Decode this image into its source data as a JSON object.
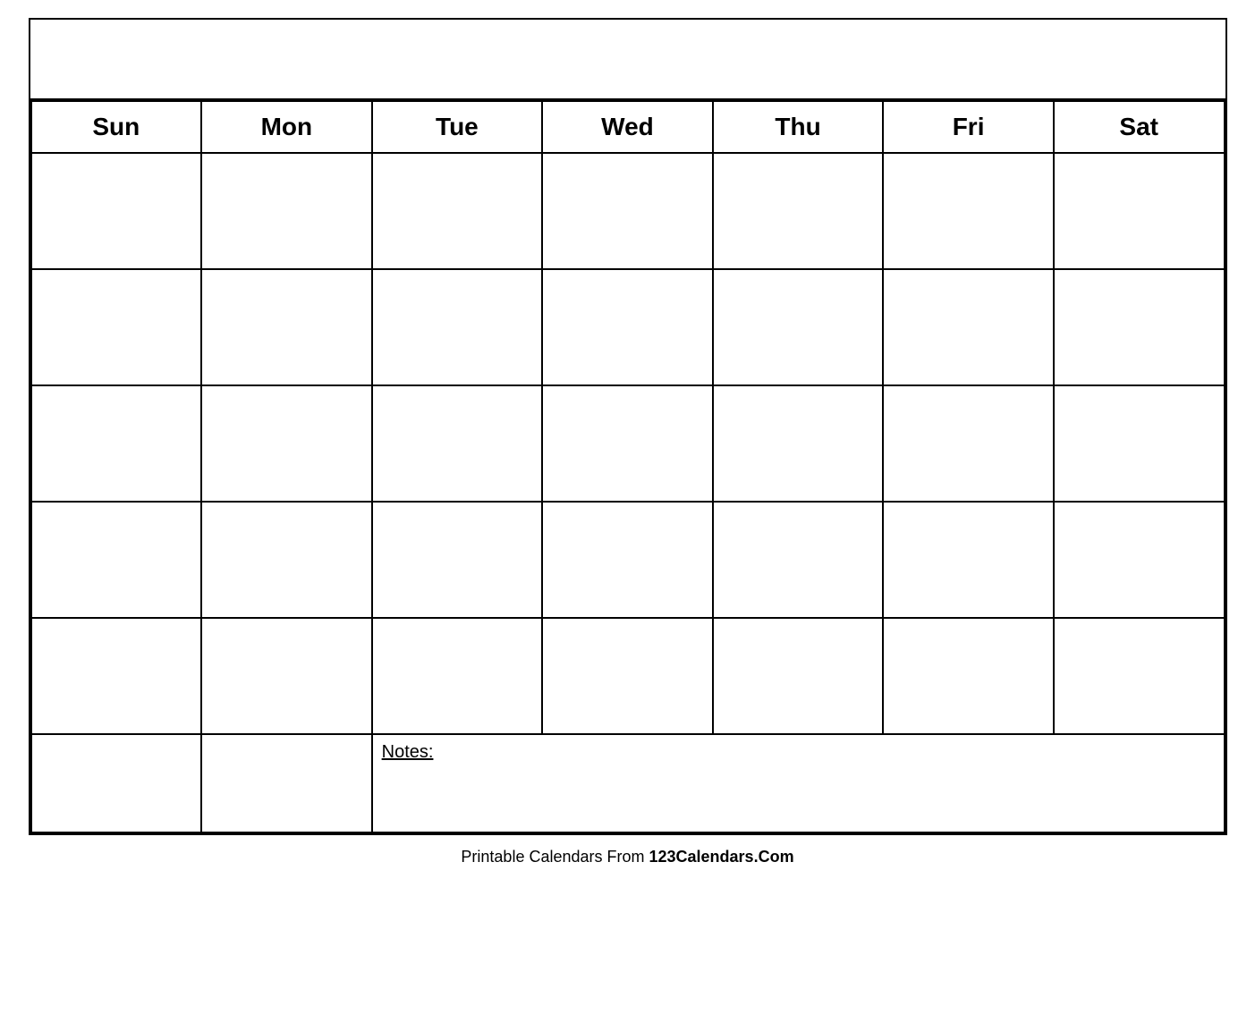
{
  "calendar": {
    "title": "",
    "days": [
      "Sun",
      "Mon",
      "Tue",
      "Wed",
      "Thu",
      "Fri",
      "Sat"
    ],
    "notes_label": "Notes:",
    "rows": 5
  },
  "footer": {
    "prefix": "Printable Calendars From ",
    "brand": "123Calendars.Com"
  }
}
